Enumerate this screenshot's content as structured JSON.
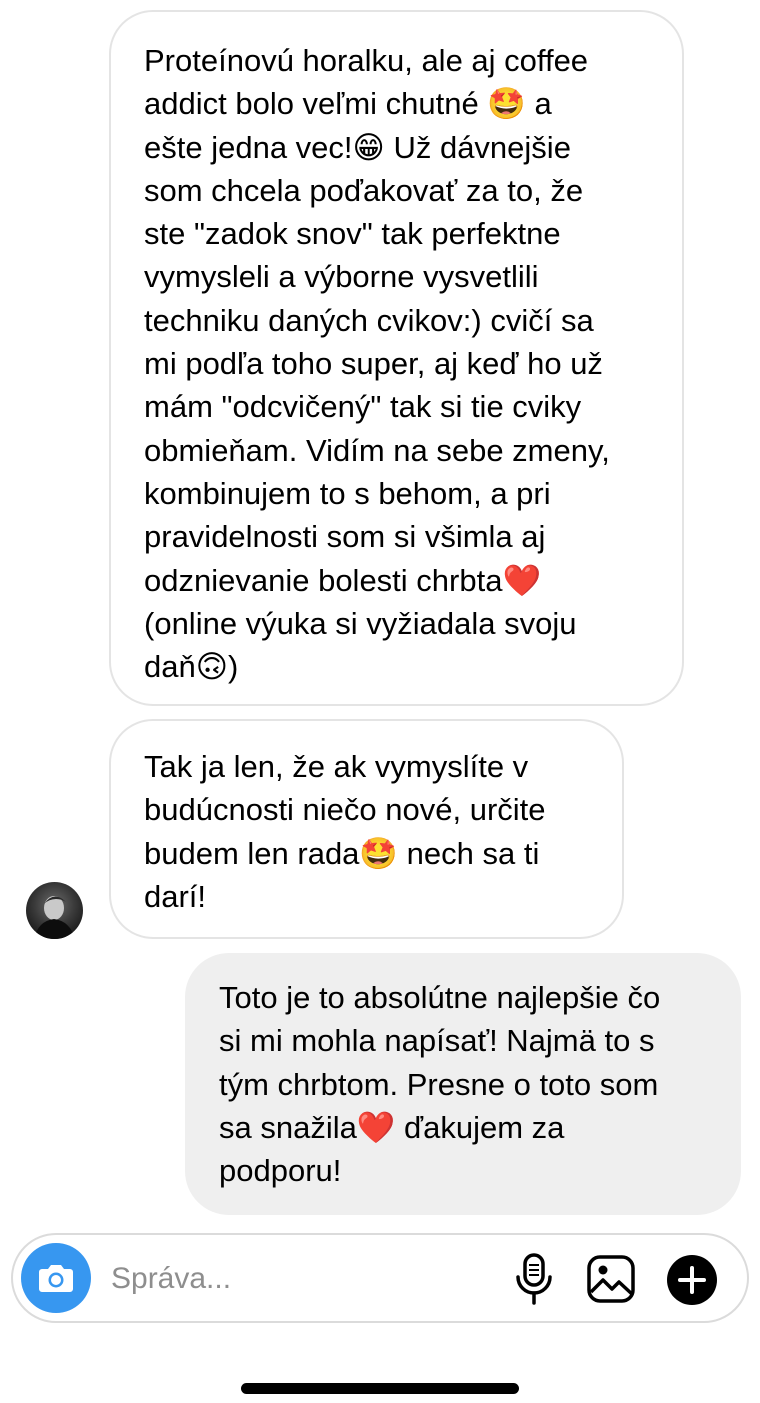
{
  "conversation": {
    "messages": [
      {
        "sender": "other",
        "lines": [
          "Proteínovú horalku, ale aj coffee",
          "addict bolo veľmi chutné 🤩 a",
          "ešte jedna vec!😁 Už dávnejšie",
          "som chcela poďakovať za to, že",
          "ste \"zadok snov\" tak perfektne",
          "vymysleli a výborne vysvetlili",
          "techniku daných cvikov:) cvičí sa",
          "mi podľa toho super, aj keď ho už",
          "mám \"odcvičený\" tak si tie cviky",
          "obmieňam. Vidím na sebe zmeny,",
          "kombinujem to s behom, a pri",
          "pravidelnosti som si všimla aj",
          "odznievanie bolesti chrbta❤️",
          "(online výuka si vyžiadala svoju",
          "daň🙃)"
        ]
      },
      {
        "sender": "other",
        "lines": [
          "Tak ja len, že ak vymyslíte v",
          "budúcnosti niečo nové, určite",
          "budem len rada🤩 nech sa ti",
          "darí!"
        ]
      },
      {
        "sender": "me",
        "lines": [
          "Toto je to absolútne najlepšie čo",
          "si mi mohla napísať! Najmä to s",
          "tým chrbtom. Presne o toto som",
          "sa snažila❤️ ďakujem za",
          "podporu!"
        ]
      }
    ]
  },
  "composer": {
    "placeholder": "Správa..."
  },
  "colors": {
    "accent": "#3797f0",
    "sent_bubble": "#efefef",
    "received_border": "#e4e4e4",
    "heart": "#e0245e"
  },
  "icons": {
    "camera": "camera-icon",
    "microphone": "microphone-icon",
    "gallery": "gallery-icon",
    "plus": "plus-circle-icon"
  }
}
